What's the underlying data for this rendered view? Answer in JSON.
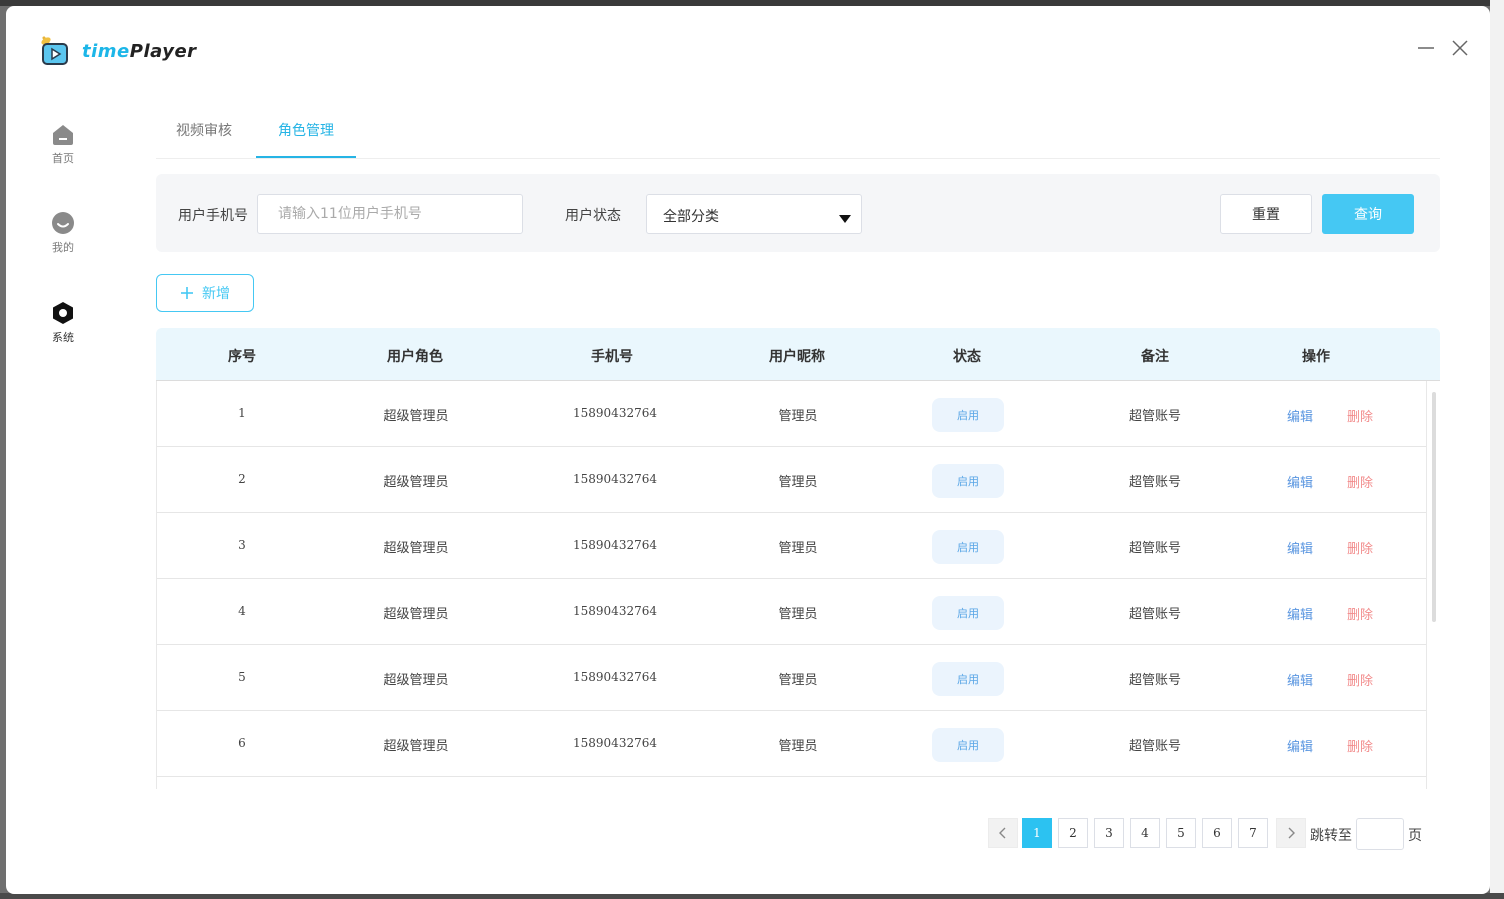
{
  "app": {
    "brand_prefix": "time",
    "brand_suffix": "Player"
  },
  "sidebar": {
    "items": [
      {
        "label": "首页",
        "icon": "home-icon"
      },
      {
        "label": "我的",
        "icon": "user-face-icon"
      },
      {
        "label": "系统",
        "icon": "settings-hex-icon",
        "active": true
      }
    ]
  },
  "tabs": [
    {
      "label": "视频审核",
      "active": false
    },
    {
      "label": "角色管理",
      "active": true
    }
  ],
  "filter": {
    "phone_label": "用户手机号",
    "phone_placeholder": "请输入11位用户手机号",
    "status_label": "用户状态",
    "status_value": "全部分类",
    "reset_label": "重置",
    "query_label": "查询"
  },
  "add_button": {
    "label": "新增"
  },
  "table": {
    "columns": [
      "序号",
      "用户角色",
      "手机号",
      "用户昵称",
      "状态",
      "备注",
      "操作"
    ],
    "rows": [
      {
        "index": "1",
        "role": "超级管理员",
        "phone": "15890432764",
        "nickname": "管理员",
        "status": "启用",
        "remark": "超管账号",
        "edit": "编辑",
        "delete": "删除"
      },
      {
        "index": "2",
        "role": "超级管理员",
        "phone": "15890432764",
        "nickname": "管理员",
        "status": "启用",
        "remark": "超管账号",
        "edit": "编辑",
        "delete": "删除"
      },
      {
        "index": "3",
        "role": "超级管理员",
        "phone": "15890432764",
        "nickname": "管理员",
        "status": "启用",
        "remark": "超管账号",
        "edit": "编辑",
        "delete": "删除"
      },
      {
        "index": "4",
        "role": "超级管理员",
        "phone": "15890432764",
        "nickname": "管理员",
        "status": "启用",
        "remark": "超管账号",
        "edit": "编辑",
        "delete": "删除"
      },
      {
        "index": "5",
        "role": "超级管理员",
        "phone": "15890432764",
        "nickname": "管理员",
        "status": "启用",
        "remark": "超管账号",
        "edit": "编辑",
        "delete": "删除"
      },
      {
        "index": "6",
        "role": "超级管理员",
        "phone": "15890432764",
        "nickname": "管理员",
        "status": "启用",
        "remark": "超管账号",
        "edit": "编辑",
        "delete": "删除"
      }
    ]
  },
  "pagination": {
    "pages": [
      "1",
      "2",
      "3",
      "4",
      "5",
      "6",
      "7"
    ],
    "current": "1",
    "jump_label": "跳转至",
    "page_suffix": "页"
  },
  "colors": {
    "accent": "#26b4e5",
    "query_button": "#45c8f3",
    "edit_link": "#5a96e0",
    "delete_link": "#f28b8b"
  }
}
